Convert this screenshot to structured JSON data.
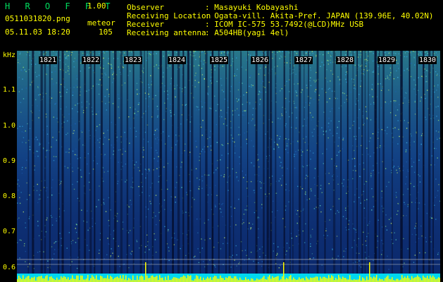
{
  "app": {
    "title": "H R O F F T",
    "version": "1.00"
  },
  "file": {
    "name": "0511031820.png",
    "datetime": "05.11.03 18:20",
    "mode": "meteor",
    "count": "105"
  },
  "station": {
    "labels": [
      "Observer",
      "Receiving Location",
      "Receiver",
      "Receiving antenna"
    ],
    "values": [
      ": Masayuki Kobayashi",
      ": Ogata-vill. Akita-Pref. JAPAN (139.96E, 40.02N)",
      ": ICOM IC-575 53.7492(@LCD)MHz USB",
      ": A504HB(yagi 4el)"
    ]
  },
  "y_axis": {
    "unit": "kHz",
    "ticks": [
      "1.1",
      "1.0",
      "0.9",
      "0.8",
      "0.7",
      "0.6"
    ]
  },
  "x_axis": {
    "ticks": [
      "1821",
      "1822",
      "1823",
      "1824",
      "1825",
      "1826",
      "1827",
      "1828",
      "1829",
      "1830"
    ]
  },
  "colors": {
    "background": "#000000",
    "text_yellow": "#ffff00",
    "title_green": "#00e060",
    "spectrum_base": "#0c2a6e"
  }
}
